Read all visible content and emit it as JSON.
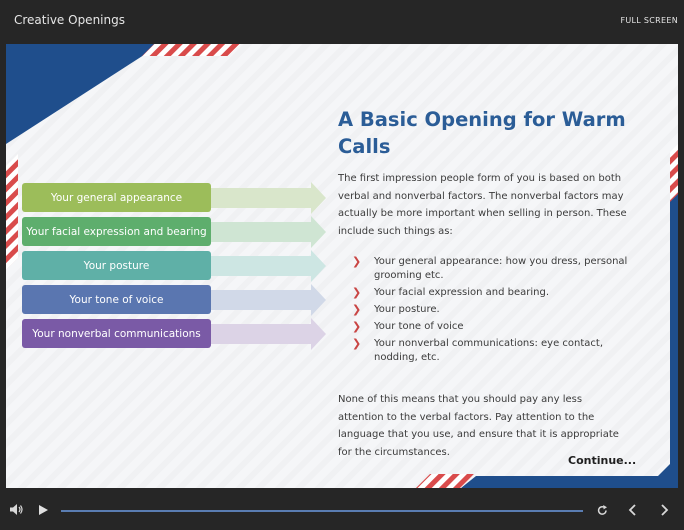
{
  "window": {
    "title": "Creative Openings",
    "fullscreen_label": "FULL SCREEN"
  },
  "slide": {
    "heading": "A Basic Opening for Warm Calls",
    "intro": "The first impression people form of you is based on both verbal and nonverbal factors. The nonverbal factors may actually be more important when selling in person. These include such things as:",
    "bullets": [
      "Your general appearance: how you dress, personal grooming etc.",
      "Your facial expression and bearing.",
      "Your posture.",
      "Your tone of voice",
      "Your nonverbal communications: eye contact, nodding, etc."
    ],
    "outro": "None of this means that you should pay any less attention to the verbal factors. Pay attention to the language that you use, and ensure that it is appropriate for the circumstances.",
    "continue_label": "Continue...",
    "diagram": [
      {
        "label": "Your general appearance",
        "color": "#9cbd5a",
        "arrow": "#d9e6cb"
      },
      {
        "label": "Your facial expression and bearing",
        "color": "#5eae6d",
        "arrow": "#cfe5d3"
      },
      {
        "label": "Your posture",
        "color": "#5fb0a7",
        "arrow": "#cde6e3"
      },
      {
        "label": "Your tone of voice",
        "color": "#5a76b0",
        "arrow": "#d1d9e8"
      },
      {
        "label": "Your nonverbal communications",
        "color": "#7a5aa6",
        "arrow": "#dcd3e6"
      }
    ]
  },
  "colors": {
    "accent_blue": "#1f4e8c",
    "accent_red": "#d94b4b",
    "heading": "#2b5d97"
  },
  "player": {
    "icons": [
      "volume-icon",
      "play-icon",
      "replay-icon",
      "previous-icon",
      "next-icon"
    ],
    "progress": 0
  }
}
